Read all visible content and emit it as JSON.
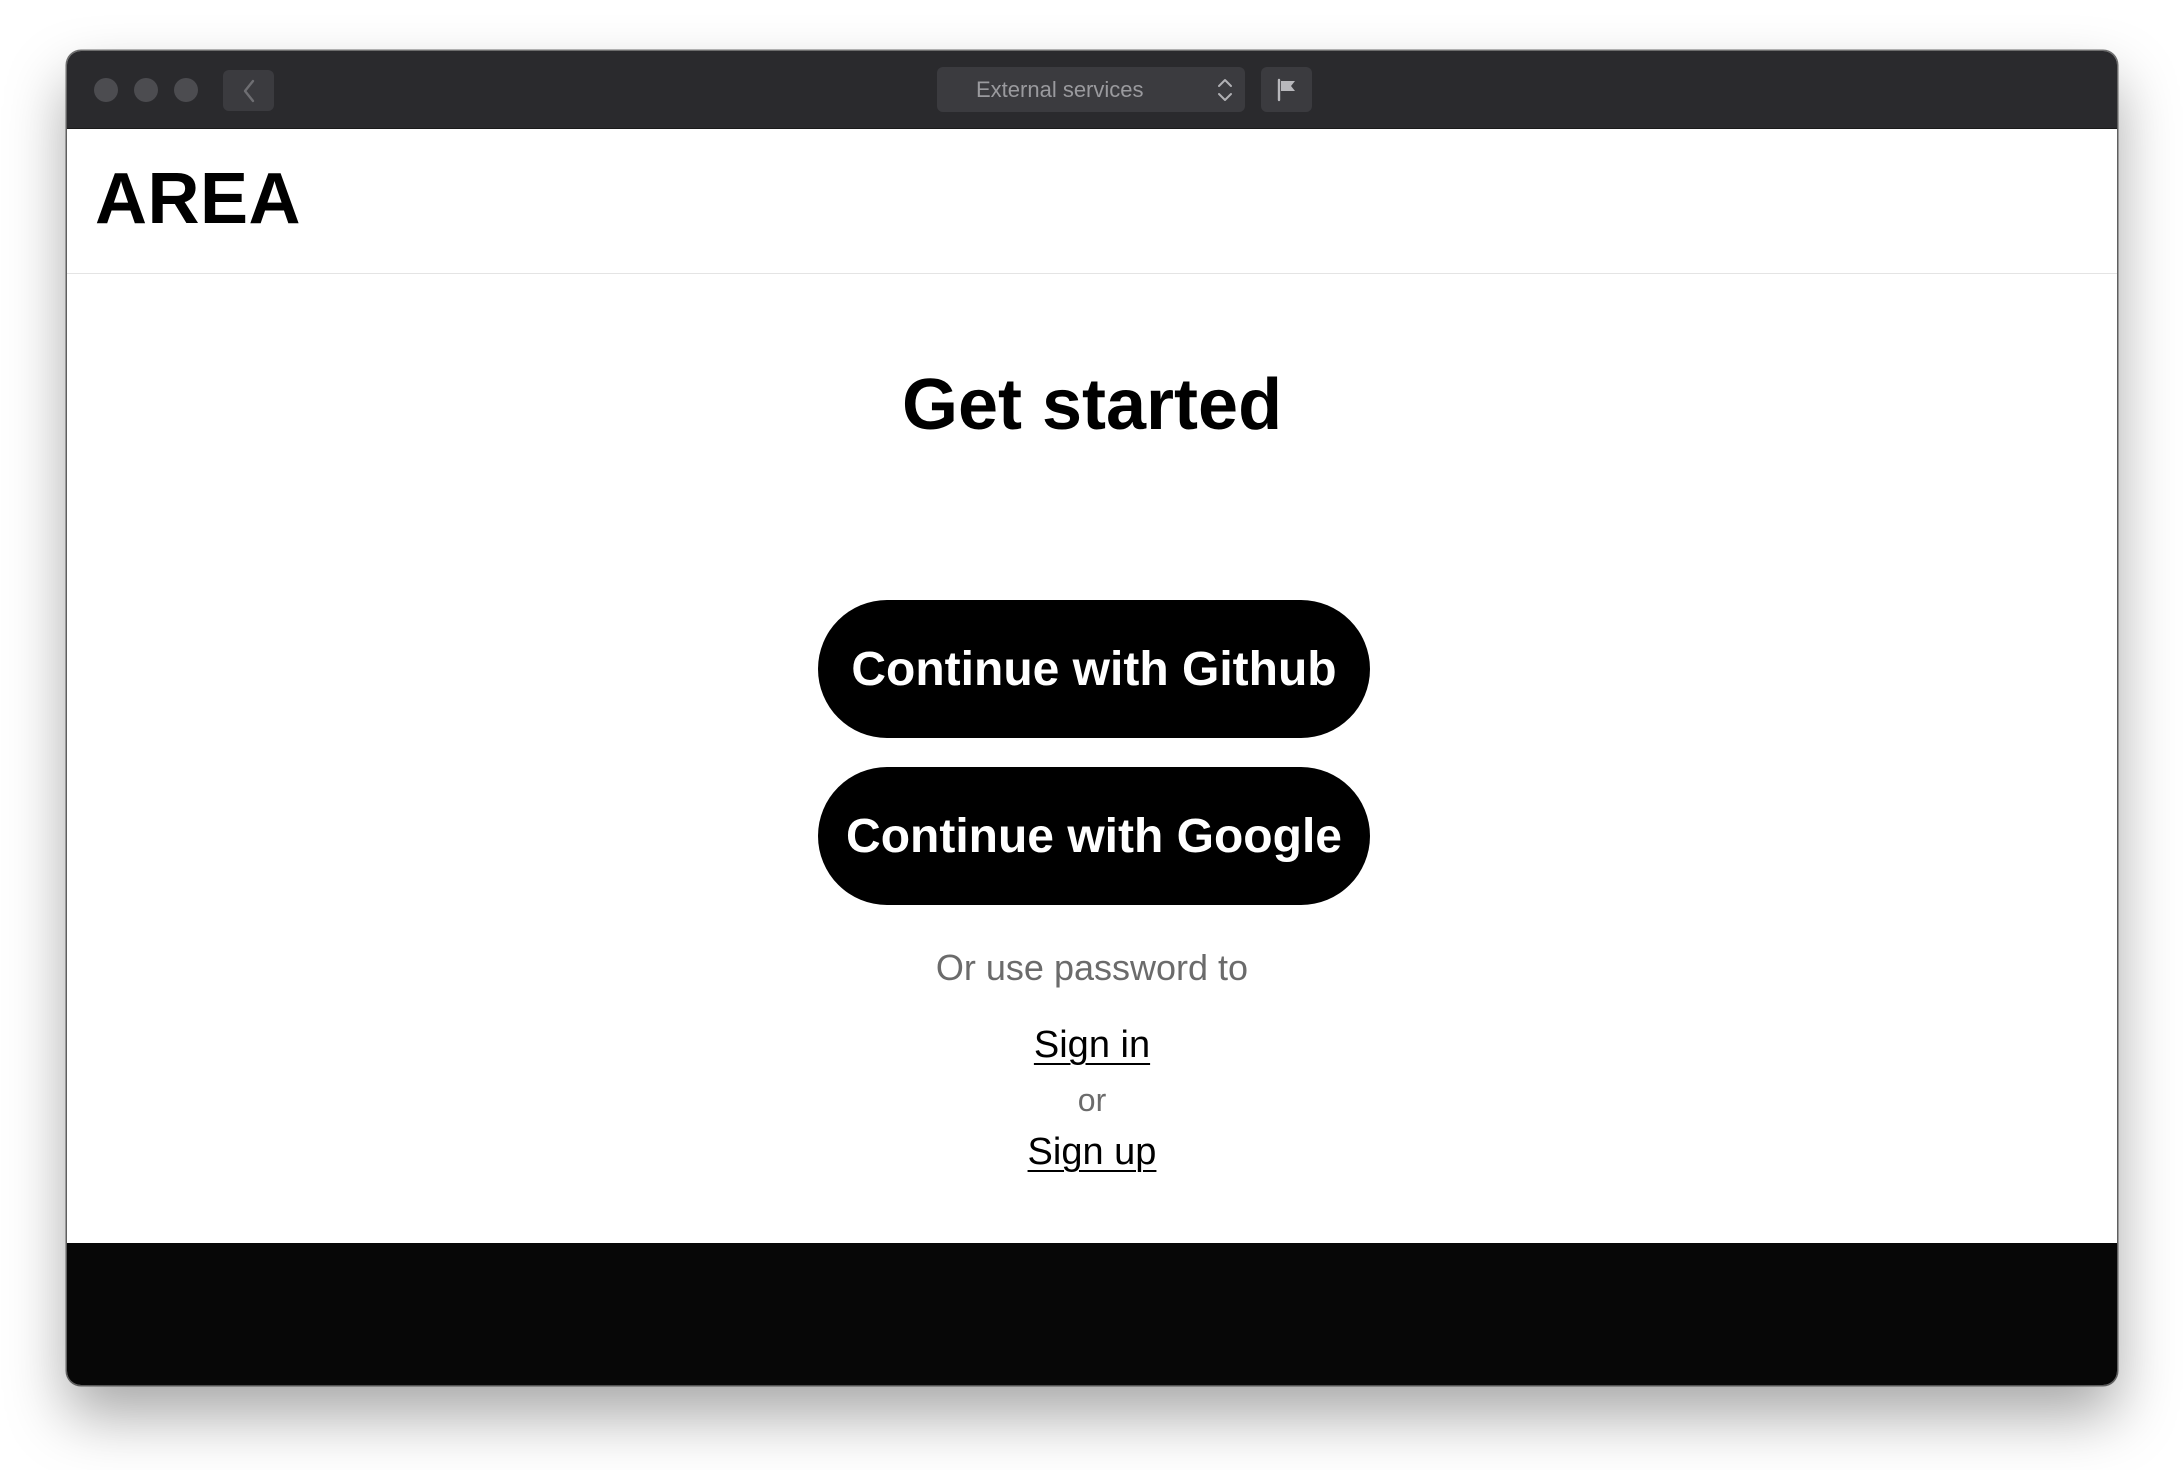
{
  "window": {
    "service_selector": "External services"
  },
  "header": {
    "logo": "AREA"
  },
  "main": {
    "title": "Get started",
    "github_button": "Continue with Github",
    "google_button": "Continue with Google",
    "password_hint": "Or use password to",
    "sign_in": "Sign in",
    "or": "or",
    "sign_up": "Sign up"
  },
  "icons": {
    "back": "chevron-left-icon",
    "select": "up-down-chevron-icon",
    "flag": "flag-icon"
  }
}
